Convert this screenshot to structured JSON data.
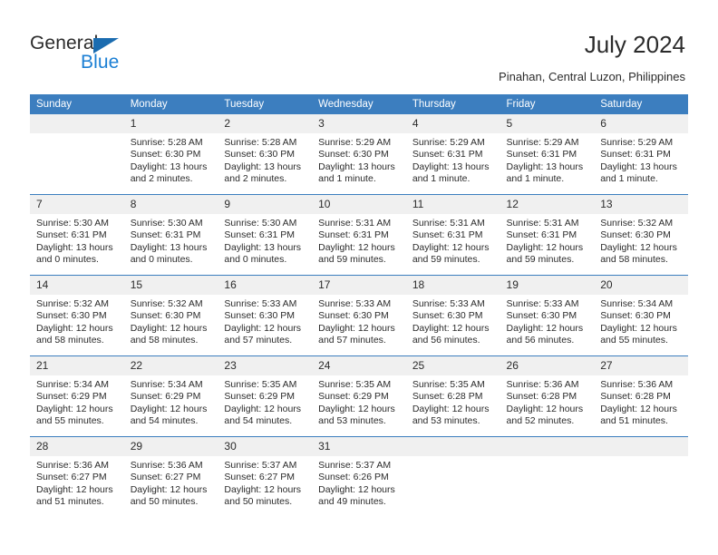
{
  "brand": {
    "name_part1": "General",
    "name_part2": "Blue",
    "triangle_icon": "triangle-icon",
    "accent_color": "#1b7fd4",
    "header_color": "#3c7ebf"
  },
  "header": {
    "title": "July 2024",
    "subtitle": "Pinahan, Central Luzon, Philippines"
  },
  "calendar": {
    "weekday_headers": [
      "Sunday",
      "Monday",
      "Tuesday",
      "Wednesday",
      "Thursday",
      "Friday",
      "Saturday"
    ],
    "weeks": [
      [
        {
          "day": "",
          "sunrise": "",
          "sunset": "",
          "daylight": "",
          "empty": true
        },
        {
          "day": "1",
          "sunrise": "Sunrise: 5:28 AM",
          "sunset": "Sunset: 6:30 PM",
          "daylight": "Daylight: 13 hours and 2 minutes."
        },
        {
          "day": "2",
          "sunrise": "Sunrise: 5:28 AM",
          "sunset": "Sunset: 6:30 PM",
          "daylight": "Daylight: 13 hours and 2 minutes."
        },
        {
          "day": "3",
          "sunrise": "Sunrise: 5:29 AM",
          "sunset": "Sunset: 6:30 PM",
          "daylight": "Daylight: 13 hours and 1 minute."
        },
        {
          "day": "4",
          "sunrise": "Sunrise: 5:29 AM",
          "sunset": "Sunset: 6:31 PM",
          "daylight": "Daylight: 13 hours and 1 minute."
        },
        {
          "day": "5",
          "sunrise": "Sunrise: 5:29 AM",
          "sunset": "Sunset: 6:31 PM",
          "daylight": "Daylight: 13 hours and 1 minute."
        },
        {
          "day": "6",
          "sunrise": "Sunrise: 5:29 AM",
          "sunset": "Sunset: 6:31 PM",
          "daylight": "Daylight: 13 hours and 1 minute."
        }
      ],
      [
        {
          "day": "7",
          "sunrise": "Sunrise: 5:30 AM",
          "sunset": "Sunset: 6:31 PM",
          "daylight": "Daylight: 13 hours and 0 minutes."
        },
        {
          "day": "8",
          "sunrise": "Sunrise: 5:30 AM",
          "sunset": "Sunset: 6:31 PM",
          "daylight": "Daylight: 13 hours and 0 minutes."
        },
        {
          "day": "9",
          "sunrise": "Sunrise: 5:30 AM",
          "sunset": "Sunset: 6:31 PM",
          "daylight": "Daylight: 13 hours and 0 minutes."
        },
        {
          "day": "10",
          "sunrise": "Sunrise: 5:31 AM",
          "sunset": "Sunset: 6:31 PM",
          "daylight": "Daylight: 12 hours and 59 minutes."
        },
        {
          "day": "11",
          "sunrise": "Sunrise: 5:31 AM",
          "sunset": "Sunset: 6:31 PM",
          "daylight": "Daylight: 12 hours and 59 minutes."
        },
        {
          "day": "12",
          "sunrise": "Sunrise: 5:31 AM",
          "sunset": "Sunset: 6:31 PM",
          "daylight": "Daylight: 12 hours and 59 minutes."
        },
        {
          "day": "13",
          "sunrise": "Sunrise: 5:32 AM",
          "sunset": "Sunset: 6:30 PM",
          "daylight": "Daylight: 12 hours and 58 minutes."
        }
      ],
      [
        {
          "day": "14",
          "sunrise": "Sunrise: 5:32 AM",
          "sunset": "Sunset: 6:30 PM",
          "daylight": "Daylight: 12 hours and 58 minutes."
        },
        {
          "day": "15",
          "sunrise": "Sunrise: 5:32 AM",
          "sunset": "Sunset: 6:30 PM",
          "daylight": "Daylight: 12 hours and 58 minutes."
        },
        {
          "day": "16",
          "sunrise": "Sunrise: 5:33 AM",
          "sunset": "Sunset: 6:30 PM",
          "daylight": "Daylight: 12 hours and 57 minutes."
        },
        {
          "day": "17",
          "sunrise": "Sunrise: 5:33 AM",
          "sunset": "Sunset: 6:30 PM",
          "daylight": "Daylight: 12 hours and 57 minutes."
        },
        {
          "day": "18",
          "sunrise": "Sunrise: 5:33 AM",
          "sunset": "Sunset: 6:30 PM",
          "daylight": "Daylight: 12 hours and 56 minutes."
        },
        {
          "day": "19",
          "sunrise": "Sunrise: 5:33 AM",
          "sunset": "Sunset: 6:30 PM",
          "daylight": "Daylight: 12 hours and 56 minutes."
        },
        {
          "day": "20",
          "sunrise": "Sunrise: 5:34 AM",
          "sunset": "Sunset: 6:30 PM",
          "daylight": "Daylight: 12 hours and 55 minutes."
        }
      ],
      [
        {
          "day": "21",
          "sunrise": "Sunrise: 5:34 AM",
          "sunset": "Sunset: 6:29 PM",
          "daylight": "Daylight: 12 hours and 55 minutes."
        },
        {
          "day": "22",
          "sunrise": "Sunrise: 5:34 AM",
          "sunset": "Sunset: 6:29 PM",
          "daylight": "Daylight: 12 hours and 54 minutes."
        },
        {
          "day": "23",
          "sunrise": "Sunrise: 5:35 AM",
          "sunset": "Sunset: 6:29 PM",
          "daylight": "Daylight: 12 hours and 54 minutes."
        },
        {
          "day": "24",
          "sunrise": "Sunrise: 5:35 AM",
          "sunset": "Sunset: 6:29 PM",
          "daylight": "Daylight: 12 hours and 53 minutes."
        },
        {
          "day": "25",
          "sunrise": "Sunrise: 5:35 AM",
          "sunset": "Sunset: 6:28 PM",
          "daylight": "Daylight: 12 hours and 53 minutes."
        },
        {
          "day": "26",
          "sunrise": "Sunrise: 5:36 AM",
          "sunset": "Sunset: 6:28 PM",
          "daylight": "Daylight: 12 hours and 52 minutes."
        },
        {
          "day": "27",
          "sunrise": "Sunrise: 5:36 AM",
          "sunset": "Sunset: 6:28 PM",
          "daylight": "Daylight: 12 hours and 51 minutes."
        }
      ],
      [
        {
          "day": "28",
          "sunrise": "Sunrise: 5:36 AM",
          "sunset": "Sunset: 6:27 PM",
          "daylight": "Daylight: 12 hours and 51 minutes."
        },
        {
          "day": "29",
          "sunrise": "Sunrise: 5:36 AM",
          "sunset": "Sunset: 6:27 PM",
          "daylight": "Daylight: 12 hours and 50 minutes."
        },
        {
          "day": "30",
          "sunrise": "Sunrise: 5:37 AM",
          "sunset": "Sunset: 6:27 PM",
          "daylight": "Daylight: 12 hours and 50 minutes."
        },
        {
          "day": "31",
          "sunrise": "Sunrise: 5:37 AM",
          "sunset": "Sunset: 6:26 PM",
          "daylight": "Daylight: 12 hours and 49 minutes."
        },
        {
          "day": "",
          "sunrise": "",
          "sunset": "",
          "daylight": "",
          "empty": true
        },
        {
          "day": "",
          "sunrise": "",
          "sunset": "",
          "daylight": "",
          "empty": true
        },
        {
          "day": "",
          "sunrise": "",
          "sunset": "",
          "daylight": "",
          "empty": true
        }
      ]
    ]
  }
}
